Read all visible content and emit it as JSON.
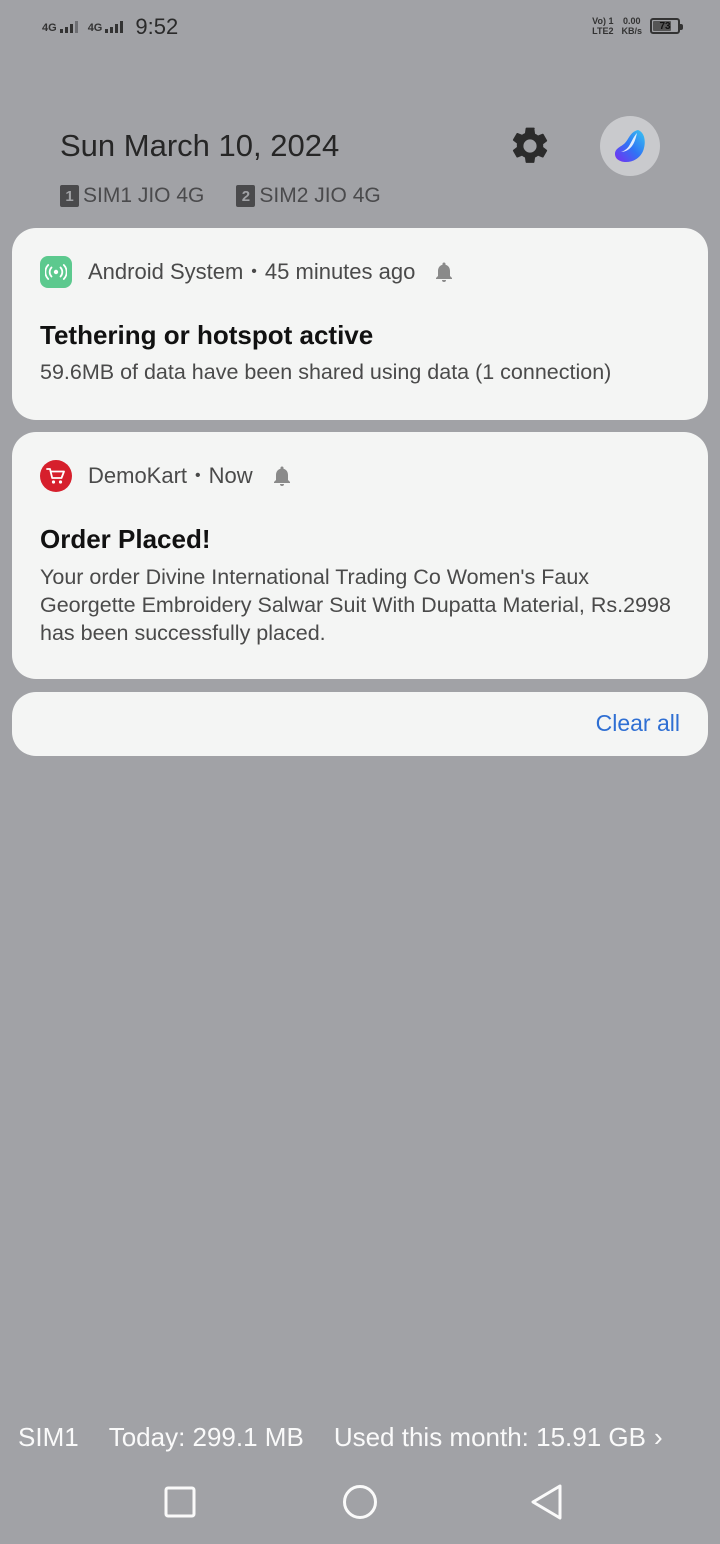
{
  "status_bar": {
    "sim1_network": "4G",
    "sim2_network": "4G",
    "time": "9:52",
    "volte_line1": "Vo) 1",
    "volte_line2": "LTE2",
    "speed_value": "0.00",
    "speed_unit": "KB/s",
    "battery_level": "73",
    "battery_fraction": 0.73
  },
  "header": {
    "date": "Sun March 10, 2024",
    "sims": [
      {
        "slot": "1",
        "label": "SIM1 JIO 4G"
      },
      {
        "slot": "2",
        "label": "SIM2 JIO 4G"
      }
    ],
    "settings_icon": "gear-icon",
    "avatar_icon": "theme-logo-icon"
  },
  "notifications": [
    {
      "app": "Android System",
      "time": "45 minutes ago",
      "icon": "hotspot-icon",
      "icon_color": "#5cc98e",
      "title": "Tethering or hotspot active",
      "body": "59.6MB of data have been shared using data (1 connection)"
    },
    {
      "app": "DemoKart",
      "time": "Now",
      "icon": "cart-icon",
      "icon_color": "#d61f2c",
      "title": "Order Placed!",
      "body": "Your order Divine International Trading Co Women's Faux Georgette Embroidery Salwar Suit With Dupatta Material, Rs.2998 has been successfully placed."
    }
  ],
  "separator": "•",
  "clear_all": "Clear all",
  "accent_color": "#2f6fd3",
  "usage": {
    "sim": "SIM1",
    "today": "Today: 299.1 MB",
    "month": "Used this month: 15.91 GB",
    "arrow": "›"
  },
  "nav": {
    "recents_icon": "square-icon",
    "home_icon": "circle-icon",
    "back_icon": "triangle-back-icon"
  }
}
